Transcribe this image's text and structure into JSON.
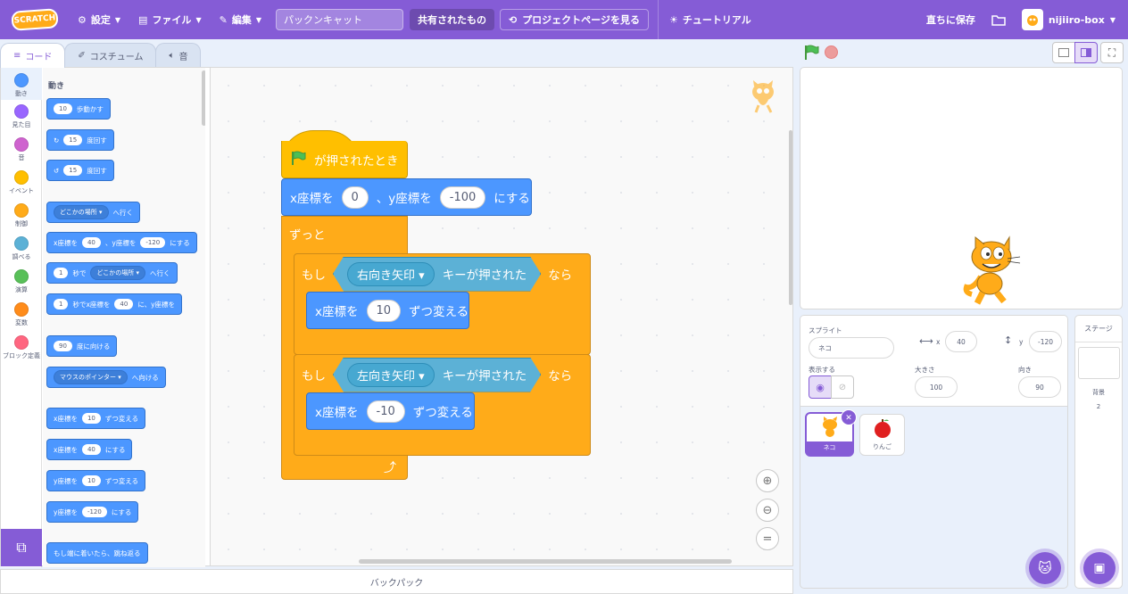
{
  "menubar": {
    "logo_text": "SCRATCH",
    "settings": "設定",
    "file": "ファイル",
    "edit": "編集",
    "project_title": "パックンキャット",
    "shared": "共有されたもの",
    "see_project_page": "プロジェクトページを見る",
    "tutorials": "チュートリアル",
    "save_now": "直ちに保存",
    "username": "nijiiro-box"
  },
  "tabs": {
    "code": "コード",
    "costumes": "コスチューム",
    "sounds": "音"
  },
  "categories": [
    {
      "label": "動き",
      "color": "#4c97ff"
    },
    {
      "label": "見た目",
      "color": "#9966ff"
    },
    {
      "label": "音",
      "color": "#cf63cf"
    },
    {
      "label": "イベント",
      "color": "#ffbf00"
    },
    {
      "label": "制御",
      "color": "#ffab19"
    },
    {
      "label": "調べる",
      "color": "#5cb1d6"
    },
    {
      "label": "演算",
      "color": "#59c059"
    },
    {
      "label": "変数",
      "color": "#ff8c1a"
    },
    {
      "label": "ブロック定義",
      "color": "#ff6680"
    }
  ],
  "palette": {
    "heading": "動き",
    "move_n": "10",
    "move_t": "歩動かす",
    "turn_r_n": "15",
    "turn_r_t": "度回す",
    "turn_l_n": "15",
    "turn_l_t": "度回す",
    "goto_d": "どこかの場所",
    "goto_t": "へ行く",
    "gotoxy_a": "x座標を",
    "gotoxy_x": "40",
    "gotoxy_b": "、y座標を",
    "gotoxy_y": "-120",
    "gotoxy_c": "にする",
    "glide_n": "1",
    "glide_a": "秒で",
    "glide_d": "どこかの場所",
    "glide_b": "へ行く",
    "glidexy_n": "1",
    "glidexy_a": "秒でx座標を",
    "glidexy_x": "40",
    "glidexy_b": "に、y座標を",
    "point_n": "90",
    "point_t": "度に向ける",
    "towards_d": "マウスのポインター",
    "towards_t": "へ向ける",
    "chx_a": "x座標を",
    "chx_n": "10",
    "chx_b": "ずつ変える",
    "setx_a": "x座標を",
    "setx_n": "40",
    "setx_b": "にする",
    "chy_a": "y座標を",
    "chy_n": "10",
    "chy_b": "ずつ変える",
    "sety_a": "y座標を",
    "sety_n": "-120",
    "sety_b": "にする",
    "bounce": "もし端に着いたら、跳ね返る"
  },
  "script": {
    "hat": "が押されたとき",
    "gotoxy_a": "x座標を",
    "gotoxy_x": "0",
    "gotoxy_b": "、y座標を",
    "gotoxy_y": "-100",
    "gotoxy_c": "にする",
    "forever": "ずっと",
    "if1_a": "もし",
    "if1_key": "右向き矢印",
    "if1_b": "キーが押された",
    "if1_c": "なら",
    "ch1_a": "x座標を",
    "ch1_n": "10",
    "ch1_b": "ずつ変える",
    "if2_a": "もし",
    "if2_key": "左向き矢印",
    "if2_b": "キーが押された",
    "if2_c": "なら",
    "ch2_a": "x座標を",
    "ch2_n": "-10",
    "ch2_b": "ずつ変える"
  },
  "backpack": "バックパック",
  "sprite_info": {
    "sprite_label": "スプライト",
    "sprite_name": "ネコ",
    "x_label": "x",
    "x_value": "40",
    "y_label": "y",
    "y_value": "-120",
    "show_label": "表示する",
    "size_label": "大きさ",
    "size_value": "100",
    "direction_label": "向き",
    "direction_value": "90"
  },
  "sprites": [
    {
      "name": "ネコ"
    },
    {
      "name": "りんご"
    }
  ],
  "stage_pane": {
    "title": "ステージ",
    "backdrops_label": "背景",
    "backdrops_count": "2"
  }
}
